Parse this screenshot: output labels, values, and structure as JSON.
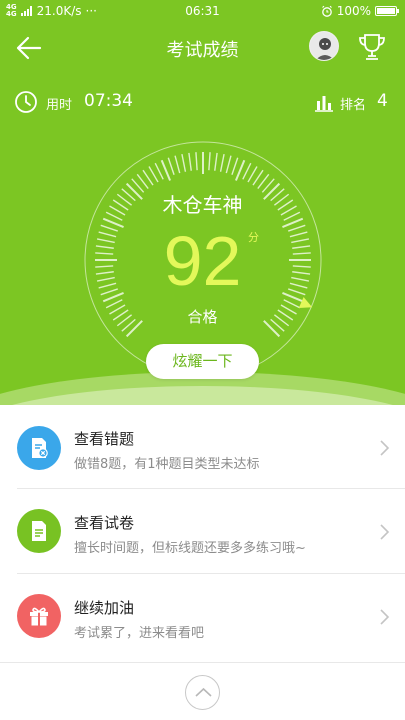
{
  "status_bar": {
    "network": "4G 4G",
    "speed": "21.0K/s",
    "dots": "···",
    "time": "06:31",
    "battery": "100%",
    "battery_level": 1.0
  },
  "nav": {
    "title": "考试成绩",
    "back_icon": "arrow-left-icon",
    "trophy_icon": "trophy-icon"
  },
  "stats": {
    "use_label": "用时",
    "use_value": "07:34",
    "rank_label": "排名",
    "rank_value": "4"
  },
  "result": {
    "player_name": "木仓车神",
    "score": "92",
    "score_unit": "分",
    "grade": "合格",
    "score_fraction": 0.92,
    "share_button": "炫耀一下"
  },
  "list": [
    {
      "title": "查看错题",
      "subtitle": "做错8题，有1种题目类型未达标",
      "icon": "error-doc-icon",
      "color": "#3aa7ea"
    },
    {
      "title": "查看试卷",
      "subtitle": "擅长时间题，但标线题还要多多练习哦~",
      "icon": "document-icon",
      "color": "#78c223"
    },
    {
      "title": "继续加油",
      "subtitle": "考试累了，进来看看吧",
      "icon": "gift-icon",
      "color": "#f16363"
    }
  ],
  "colors": {
    "hero": "#7cc623",
    "score": "#e3f85a",
    "accent_blue": "#3aa7ea",
    "accent_green": "#78c223",
    "accent_red": "#f16363"
  }
}
